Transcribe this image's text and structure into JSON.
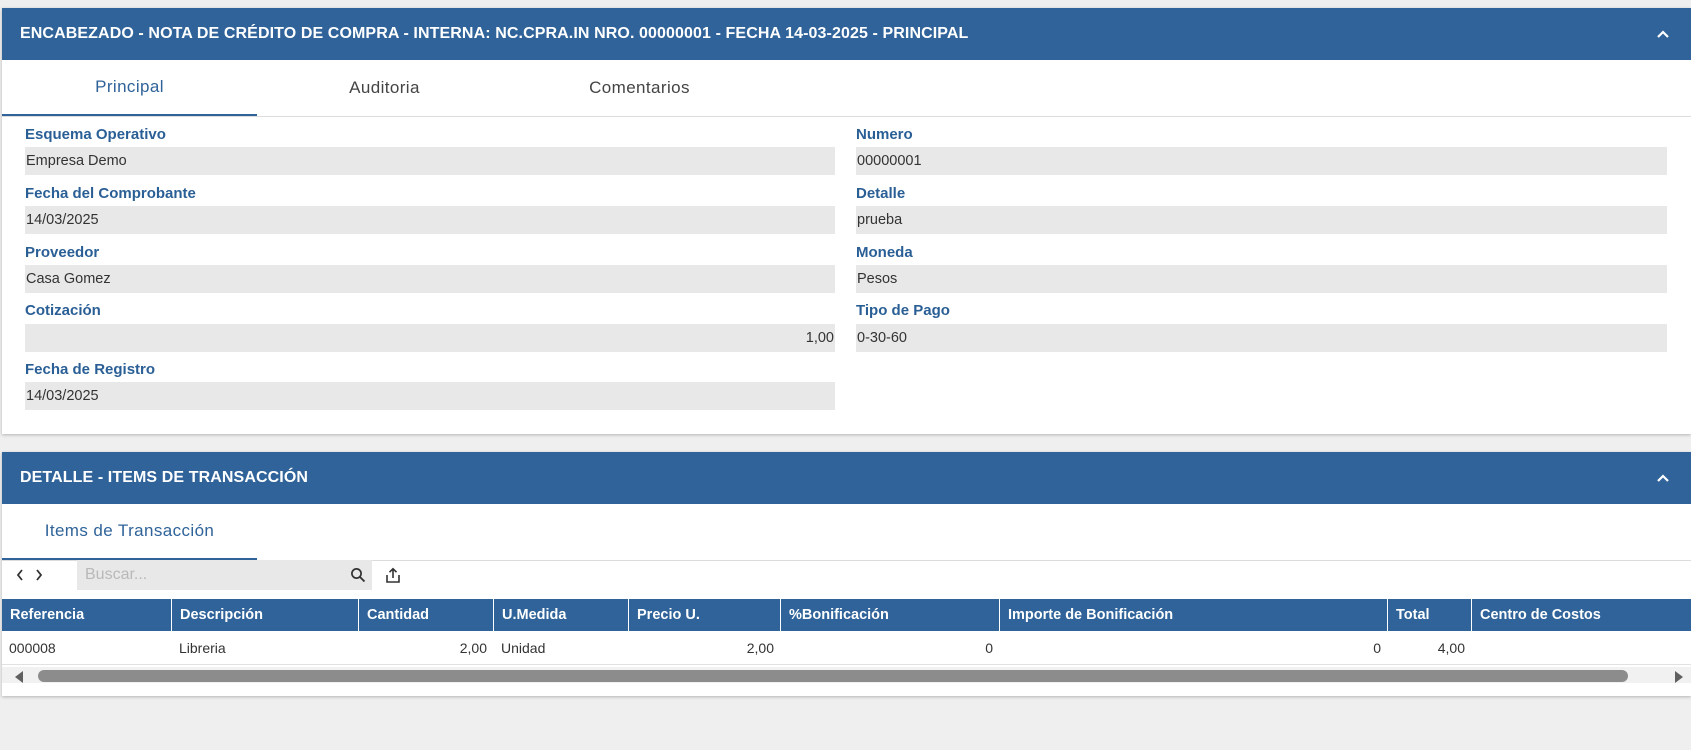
{
  "header_panel": {
    "title": "ENCABEZADO - NOTA DE CRÉDITO DE COMPRA - INTERNA: NC.CPRA.IN NRO. 00000001 - FECHA 14-03-2025 - PRINCIPAL",
    "tabs": [
      "Principal",
      "Auditoria",
      "Comentarios"
    ],
    "active_tab": "Principal",
    "fields": {
      "esquema": {
        "label": "Esquema Operativo",
        "value": "Empresa Demo"
      },
      "fecha_comprobante": {
        "label": "Fecha del Comprobante",
        "value": "14/03/2025"
      },
      "proveedor": {
        "label": "Proveedor",
        "value": "Casa Gomez"
      },
      "cotizacion": {
        "label": "Cotización",
        "value": "1,00"
      },
      "fecha_registro": {
        "label": "Fecha de Registro",
        "value": "14/03/2025"
      },
      "numero": {
        "label": "Numero",
        "value": "00000001"
      },
      "detalle": {
        "label": "Detalle",
        "value": "prueba"
      },
      "moneda": {
        "label": "Moneda",
        "value": "Pesos"
      },
      "tipo_pago": {
        "label": "Tipo de Pago",
        "value": "0-30-60"
      }
    }
  },
  "detail_panel": {
    "title": "DETALLE - ITEMS DE TRANSACCIÓN",
    "tabs": [
      "Items de Transacción"
    ],
    "search": {
      "placeholder": "Buscar...",
      "value": ""
    },
    "columns": [
      "Referencia",
      "Descripción",
      "Cantidad",
      "U.Medida",
      "Precio U.",
      "%Bonificación",
      "Importe de Bonificación",
      "Total",
      "Centro de Costos"
    ],
    "rows": [
      [
        "000008",
        "Libreria",
        "2,00",
        "Unidad",
        "2,00",
        "0",
        "0",
        "4,00",
        ""
      ]
    ]
  },
  "icons": {
    "collapse": "chevron-up-icon",
    "prev": "chevron-left-icon",
    "next": "chevron-right-icon",
    "search": "search-icon",
    "export": "export-icon"
  },
  "colors": {
    "primary": "#2f6399",
    "label": "#2a5f96",
    "field_bg": "#e8e8e8"
  }
}
